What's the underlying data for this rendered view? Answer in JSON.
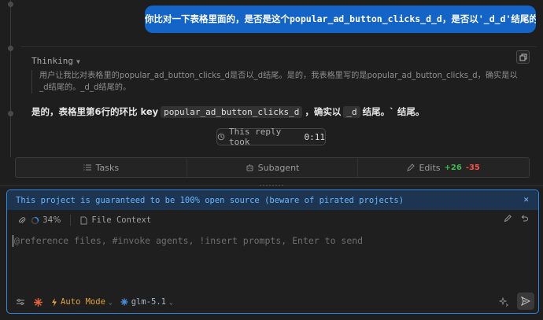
{
  "user_message": "你比对一下表格里面的，是否是这个popular_ad_button_clicks_d_d，是否以'_d_d'结尾的",
  "thinking": {
    "label": "Thinking",
    "text": "用户让我比对表格里的popular_ad_button_clicks_d是否以_d结尾。是的，我表格里写的是popular_ad_button_clicks_d，确实是以_d结尾的。_d_d结尾的。"
  },
  "answer": {
    "prefix": "是的，表格里第6行的环比 key",
    "code1": "popular_ad_button_clicks_d",
    "middle": "，确实以",
    "code2": "_d",
    "suffix": "结尾。` 结尾。"
  },
  "reply_time": {
    "prefix": "This reply took",
    "value": "0:11"
  },
  "toolbar": {
    "tasks": "Tasks",
    "subagent": "Subagent",
    "edits": "Edits",
    "added": "+26",
    "removed": "-35"
  },
  "notice": "This project is guaranteed to be 100% open source (beware of pirated projects)",
  "context": {
    "percent": "34%",
    "file_context": "File Context"
  },
  "input": {
    "placeholder": "@reference files, #invoke agents, !insert prompts, Enter to send"
  },
  "bottom": {
    "mode": "Auto Mode",
    "model": "glm-5.1"
  },
  "colors": {
    "accent": "#2f87e6",
    "user_bubble": "#1463c7",
    "mode": "#e2a33a",
    "added": "#3fb950",
    "removed": "#f85149"
  }
}
